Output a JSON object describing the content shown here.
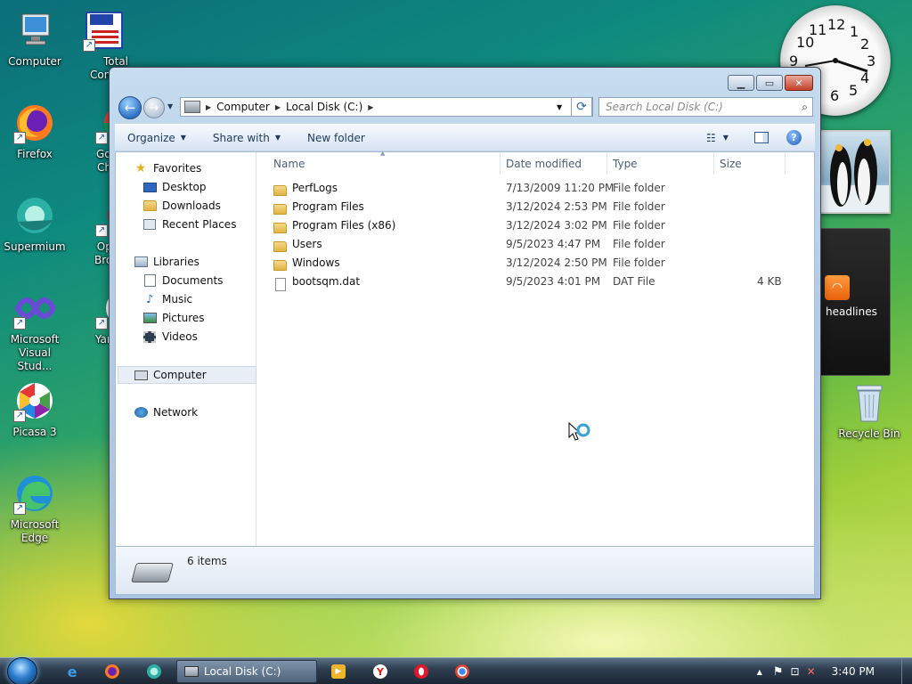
{
  "desktop": {
    "icons": [
      {
        "label": "Computer"
      },
      {
        "label": "Total Comma..."
      },
      {
        "label": "Firefox"
      },
      {
        "label": "Goog Chro"
      },
      {
        "label": "Supermium"
      },
      {
        "label": "Ope Brow"
      },
      {
        "label": "Microsoft Visual Stud..."
      },
      {
        "label": "Yand"
      },
      {
        "label": "Picasa 3"
      },
      {
        "label": "Microsoft Edge"
      },
      {
        "label": "Recycle Bin"
      }
    ],
    "gadgets": {
      "clock_numbers": [
        "12",
        "1",
        "2",
        "3",
        "4",
        "5",
        "6",
        "9",
        "10",
        "11"
      ],
      "feed_label": "headlines"
    }
  },
  "window": {
    "title": "Local Disk (C:)",
    "address": {
      "crumbs": [
        "Computer",
        "Local Disk (C:)"
      ]
    },
    "search_placeholder": "Search Local Disk (C:)",
    "toolbar": {
      "organize": "Organize",
      "share_with": "Share with",
      "new_folder": "New folder"
    },
    "nav": {
      "favorites": "Favorites",
      "favorites_items": [
        "Desktop",
        "Downloads",
        "Recent Places"
      ],
      "libraries": "Libraries",
      "libraries_items": [
        "Documents",
        "Music",
        "Pictures",
        "Videos"
      ],
      "computer": "Computer",
      "network": "Network"
    },
    "columns": {
      "name": "Name",
      "date": "Date modified",
      "type": "Type",
      "size": "Size"
    },
    "files": [
      {
        "name": "PerfLogs",
        "date": "7/13/2009 11:20 PM",
        "type": "File folder",
        "size": "",
        "kind": "folder"
      },
      {
        "name": "Program Files",
        "date": "3/12/2024 2:53 PM",
        "type": "File folder",
        "size": "",
        "kind": "folder"
      },
      {
        "name": "Program Files (x86)",
        "date": "3/12/2024 3:02 PM",
        "type": "File folder",
        "size": "",
        "kind": "folder"
      },
      {
        "name": "Users",
        "date": "9/5/2023 4:47 PM",
        "type": "File folder",
        "size": "",
        "kind": "folder"
      },
      {
        "name": "Windows",
        "date": "3/12/2024 2:50 PM",
        "type": "File folder",
        "size": "",
        "kind": "folder"
      },
      {
        "name": "bootsqm.dat",
        "date": "9/5/2023 4:01 PM",
        "type": "DAT File",
        "size": "4 KB",
        "kind": "file"
      }
    ],
    "status": "6 items"
  },
  "taskbar": {
    "active_task": "Local Disk (C:)",
    "clock": "3:40 PM"
  }
}
